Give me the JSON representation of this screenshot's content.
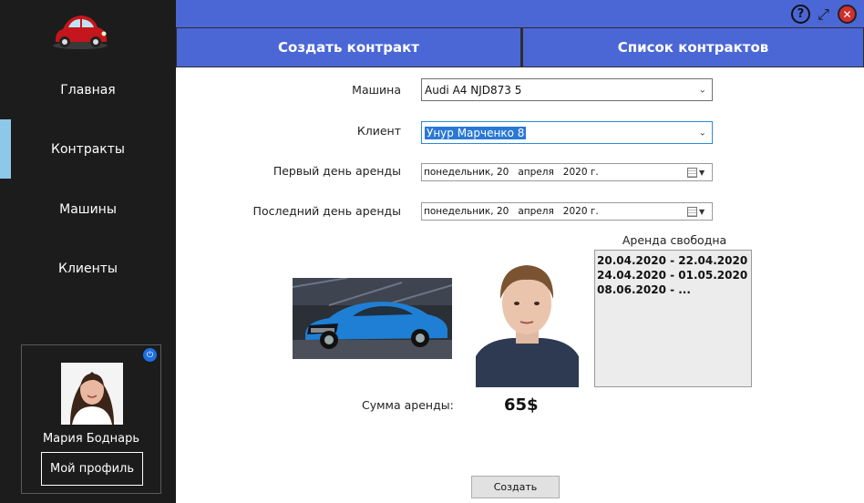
{
  "sidebar": {
    "logo": "red-beetle-car-logo",
    "items": [
      {
        "label": "Главная"
      },
      {
        "label": "Контракты"
      },
      {
        "label": "Машины"
      },
      {
        "label": "Клиенты"
      }
    ],
    "active_index": 1,
    "profile": {
      "name": "Мария Боднарь",
      "button": "Мой профиль"
    }
  },
  "window": {
    "help_icon": "?",
    "expand_icon": "⤢",
    "close_icon": "✕"
  },
  "tabs": [
    {
      "label": "Создать контракт"
    },
    {
      "label": "Список контрактов"
    }
  ],
  "form": {
    "car_label": "Машина",
    "car_value": "Audi A4 NJD873 5",
    "client_label": "Клиент",
    "client_value": "Унур Марченко 8",
    "start_label": "Первый день аренды",
    "start_value": "понедельник, 20   апреля   2020 г.",
    "end_label": "Последний день аренды",
    "end_value": "понедельник, 20   апреля   2020 г."
  },
  "availability": {
    "title": "Аренда свободна",
    "periods": [
      "20.04.2020 - 22.04.2020",
      "24.04.2020 - 01.05.2020",
      "08.06.2020 - ..."
    ]
  },
  "sum": {
    "label": "Сумма аренды:",
    "value": "65$"
  },
  "create_button": "Создать",
  "colors": {
    "accent": "#4b67d6",
    "sidebar": "#1c1c1c",
    "active_marker": "#8dc8e8",
    "car": "#1f7fd4"
  }
}
